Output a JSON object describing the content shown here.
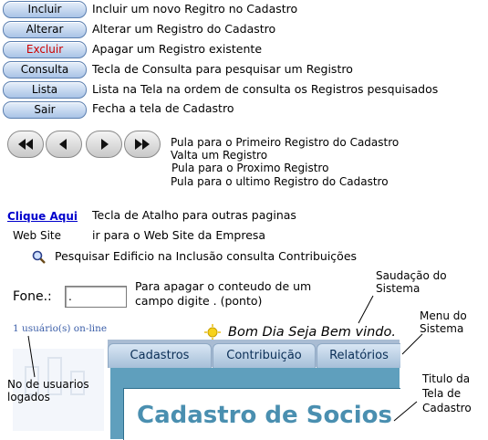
{
  "buttons": [
    {
      "label": "Incluir",
      "desc": "Incluir um novo Regitro no Cadastro"
    },
    {
      "label": "Alterar",
      "desc": "Alterar um Registro do Cadastro"
    },
    {
      "label": "Excluir",
      "desc": "Apagar um Registro existente"
    },
    {
      "label": "Consulta",
      "desc": "Tecla de Consulta para pesquisar um Registro"
    },
    {
      "label": "Lista",
      "desc": "Lista na Tela na ordem de consulta os Registros pesquisados"
    },
    {
      "label": "Sair",
      "desc": "Fecha a tela de Cadastro"
    }
  ],
  "nav": {
    "first": "Pula para o Primeiro Registro do Cadastro",
    "prev": "Valta um Registro",
    "next": "Pula para o Proximo Registro",
    "last": "Pula para o ultimo Registro do Cadastro"
  },
  "link": {
    "label": "Clique Aqui",
    "desc": "Tecla de Atalho para outras paginas"
  },
  "website": {
    "label": "Web Site",
    "desc": "ir para o Web Site da Empresa"
  },
  "search": {
    "desc": "Pesquisar Edificio na Inclusão consulta Contribuições"
  },
  "fone": {
    "label": "Fone.:",
    "value": ".",
    "desc_line1": "Para apagar o conteudo de um",
    "desc_line2": "campo digite . (ponto)"
  },
  "preview": {
    "users_online": "1 usuário(s) on-line",
    "greeting": "Bom Dia Seja Bem vindo.",
    "tabs": [
      "Cadastros",
      "Contribuição",
      "Relatórios"
    ],
    "title": "Cadastro de Socios"
  },
  "annotations": {
    "saudacao_1": "Saudação do",
    "saudacao_2": "Sistema",
    "menu_1": "Menu do",
    "menu_2": "Sistema",
    "usuarios_1": "No de usuarios",
    "usuarios_2": "logados",
    "titulo_1": "Titulo da",
    "titulo_2": "Tela de",
    "titulo_3": "Cadastro"
  },
  "colors": {
    "button_red": "#cc0000",
    "link": "#0000cc",
    "title": "#4a8fb0"
  }
}
